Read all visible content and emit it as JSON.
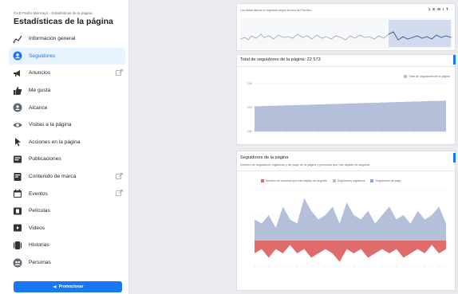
{
  "sidebar": {
    "breadcrumb": "GAD Pedro Moncayo · Estadísticas de la página",
    "title": "Estadísticas de la página",
    "items": [
      {
        "label": "Información general",
        "icon": "trend-icon",
        "active": false,
        "external": false
      },
      {
        "label": "Seguidores",
        "icon": "followers-icon",
        "active": true,
        "external": false
      },
      {
        "label": "Anuncios",
        "icon": "megaphone-icon",
        "active": false,
        "external": true
      },
      {
        "label": "Me gusta",
        "icon": "thumbs-up-icon",
        "active": false,
        "external": false
      },
      {
        "label": "Alcance",
        "icon": "reach-icon",
        "active": false,
        "external": false
      },
      {
        "label": "Visitas a la página",
        "icon": "eye-icon",
        "active": false,
        "external": false
      },
      {
        "label": "Acciones en la página",
        "icon": "cursor-icon",
        "active": false,
        "external": false
      },
      {
        "label": "Publicaciones",
        "icon": "posts-icon",
        "active": false,
        "external": false
      },
      {
        "label": "Contenido de marca",
        "icon": "branded-content-icon",
        "active": false,
        "external": true
      },
      {
        "label": "Eventos",
        "icon": "calendar-icon",
        "active": false,
        "external": true
      },
      {
        "label": "Películas",
        "icon": "film-icon",
        "active": false,
        "external": false
      },
      {
        "label": "Videos",
        "icon": "video-icon",
        "active": false,
        "external": false
      },
      {
        "label": "Historias",
        "icon": "stories-icon",
        "active": false,
        "external": false
      },
      {
        "label": "Personas",
        "icon": "people-icon",
        "active": false,
        "external": false
      }
    ],
    "promote_label": "Promocionar"
  },
  "top_card": {
    "note": "Los datos diarios se registran según la hora del Pacífico.",
    "range_buttons": [
      "1",
      "E",
      "M",
      "I",
      "T"
    ]
  },
  "total_followers": {
    "title": "Total de seguidores de la página: 22 573",
    "legend": "Total de seguidores de la página",
    "ytick_labels": [
      "20K",
      "22K",
      "24K"
    ]
  },
  "page_followers": {
    "title": "Seguidores de la página",
    "subtitle": "Número de seguidores orgánicos y de pago de la página y personas que han dejado de seguirla.",
    "legend": [
      {
        "label": "Número de usuarios que han dejado de seguirle",
        "color": "#e06b6b"
      },
      {
        "label": "Seguidores orgánicos",
        "color": "#b4bfd9"
      },
      {
        "label": "Seguidores de pago",
        "color": "#8da6d4"
      }
    ]
  },
  "colors": {
    "accent": "#1877f2",
    "area_blue": "#b4bfd9",
    "area_red": "#e06b6b",
    "active_bg": "#e7f3ff"
  },
  "chart_data": [
    {
      "type": "area",
      "title": "Total de seguidores de la página: 22 573",
      "series": [
        {
          "name": "Total de seguidores de la página",
          "values": [
            22100,
            22120,
            22140,
            22160,
            22180,
            22200,
            22220,
            22240,
            22260,
            22280,
            22300,
            22320,
            22340,
            22360,
            22380,
            22400,
            22420,
            22440,
            22460,
            22480,
            22500,
            22520,
            22540,
            22560,
            22573
          ]
        }
      ],
      "ylim": [
        20000,
        24000
      ]
    },
    {
      "type": "area",
      "title": "Seguidores de la página",
      "series": [
        {
          "name": "Seguidores orgánicos",
          "values": [
            5,
            4,
            6,
            3,
            8,
            5,
            4,
            10,
            7,
            5,
            6,
            8,
            4,
            9,
            6,
            5,
            7,
            4,
            6,
            8,
            5,
            6,
            4,
            7,
            5,
            6,
            8,
            4
          ]
        },
        {
          "name": "Número de usuarios que han dejado de seguirle",
          "values": [
            -3,
            -2,
            -4,
            -2,
            -3,
            -1,
            -3,
            -2,
            -4,
            -3,
            -2,
            -3,
            -5,
            -2,
            -3,
            -2,
            -4,
            -3,
            -2,
            -3,
            -2,
            -4,
            -3,
            -2,
            -3,
            -1,
            -3,
            -2
          ]
        }
      ],
      "ylim": [
        -6,
        12
      ]
    }
  ]
}
